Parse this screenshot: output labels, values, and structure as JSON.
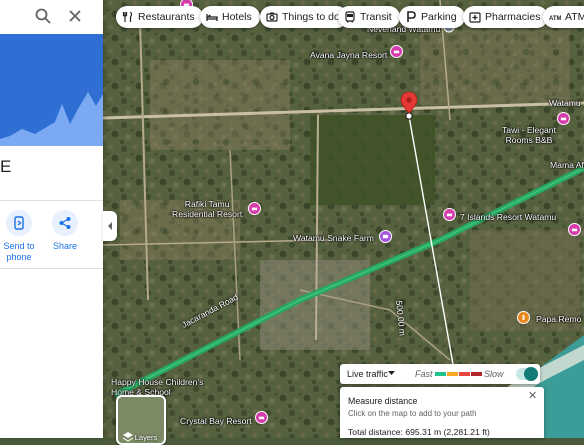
{
  "panel": {
    "place_letter": "E",
    "send_label": "Send to\nphone",
    "share_label": "Share"
  },
  "chips": [
    {
      "label": "Restaurants",
      "icon": "fork-knife-icon"
    },
    {
      "label": "Hotels",
      "icon": "bed-icon"
    },
    {
      "label": "Things to do",
      "icon": "camera-icon"
    },
    {
      "label": "Transit",
      "icon": "bus-icon"
    },
    {
      "label": "Parking",
      "icon": "parking-icon"
    },
    {
      "label": "Pharmacies",
      "icon": "pharmacy-icon"
    },
    {
      "label": "ATMs",
      "icon": "atm-icon"
    }
  ],
  "map_labels": {
    "neverland": "Neverland Watamu",
    "avana": "Avana Jayna Resort",
    "watamu_right": "Watamu",
    "tawi": "Tawi - Elegant\nRooms B&B",
    "mama": "Mama Afr",
    "rafiki": "Rafiki Tamu\nResidential Resort",
    "snake_farm": "Watamu Snake Farm",
    "seven_islands": "7 Islands Resort Watamu",
    "papa_remo": "Papa Remo",
    "happy_house": "Happy House Children's\nHome & School",
    "crystal_bay": "Crystal Bay Resort",
    "road": "Jacaranda Road",
    "distance_on_line": "500.00 m"
  },
  "traffic": {
    "label": "Live traffic",
    "fast": "Fast",
    "slow": "Slow",
    "colors": [
      "#1ec38b",
      "#f5a623",
      "#e8453c",
      "#b3262a"
    ]
  },
  "measure": {
    "title": "Measure distance",
    "hint": "Click on the map to add to your path",
    "total": "Total distance: 695.31 m (2,281.21 ft)"
  },
  "layers": {
    "label": "Layers"
  },
  "colors": {
    "accent": "#1a73e8",
    "hotel_pin": "#d63cab",
    "attraction_pin": "#a355e0",
    "food_pin": "#e8871e",
    "red_marker": "#e53935",
    "road_green": "#27a862"
  }
}
